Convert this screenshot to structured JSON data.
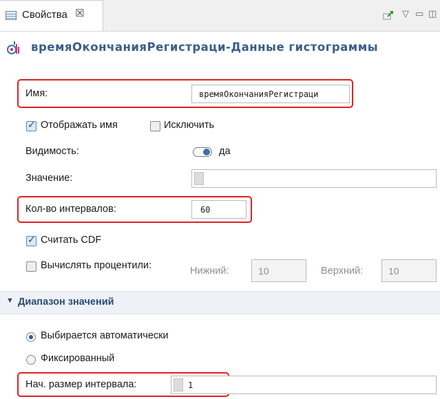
{
  "tab": {
    "label": "Свойства",
    "close_glyph": "☒"
  },
  "toolbar": {
    "pin_icon": "pin-icon",
    "menu_glyph": "▽",
    "minimize_glyph": "▭",
    "maximize_glyph": "◫"
  },
  "title": {
    "text": "времяОкончанияРегистраци-Данные гистограммы",
    "icon": "histogram-data-icon"
  },
  "form": {
    "name": {
      "label": "Имя:",
      "value": "времяОкончанияРегистраци"
    },
    "show_name": {
      "label": "Отображать имя",
      "checked": true
    },
    "exclude": {
      "label": "Исключить",
      "checked": false
    },
    "visibility": {
      "label": "Видимость:",
      "value": "да"
    },
    "value": {
      "label": "Значение:",
      "value": ""
    },
    "intervals": {
      "label": "Кол-во интервалов:",
      "value": "60"
    },
    "cdf": {
      "label": "Считать CDF",
      "checked": true
    },
    "percentiles": {
      "label": "Вычислять процентили:",
      "checked": false,
      "lower_label": "Нижний:",
      "lower_value": "10",
      "upper_label": "Верхний:",
      "upper_value": "10"
    }
  },
  "section": {
    "label": "Диапазон значений",
    "auto": {
      "label": "Выбирается автоматически",
      "selected": true
    },
    "fixed": {
      "label": "Фиксированный",
      "selected": false
    },
    "initial_size": {
      "label": "Нач. размер интервала:",
      "value": "1"
    }
  },
  "colors": {
    "title": "#3a5d89",
    "highlight": "#e02020",
    "section": "#2e4a73"
  }
}
